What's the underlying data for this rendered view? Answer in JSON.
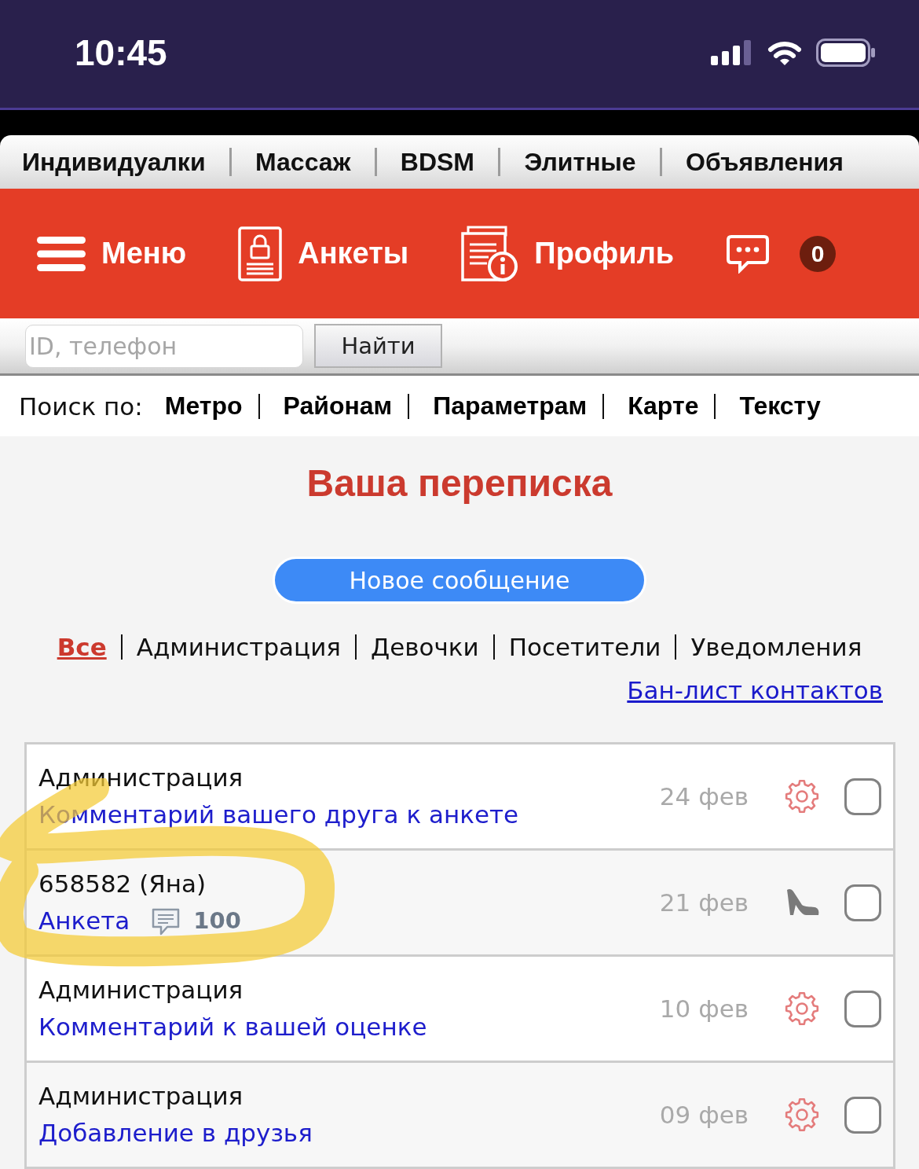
{
  "status_bar": {
    "time": "10:45"
  },
  "category_nav": {
    "items": [
      "Индивидуалки",
      "Массаж",
      "BDSM",
      "Элитные",
      "Объявления"
    ]
  },
  "main_nav": {
    "items": [
      {
        "kind": "menu",
        "label": "Меню"
      },
      {
        "kind": "profiles",
        "label": "Анкеты"
      },
      {
        "kind": "profile",
        "label": "Профиль"
      },
      {
        "kind": "messages",
        "badge": "0"
      }
    ]
  },
  "search": {
    "placeholder": "ID, телефон",
    "button": "Найти"
  },
  "search_by": {
    "label": "Поиск по:",
    "links": [
      "Метро",
      "Районам",
      "Параметрам",
      "Карте",
      "Тексту"
    ]
  },
  "title": "Ваша переписка",
  "new_message_button": "Новое сообщение",
  "filters": [
    {
      "label": "Все",
      "selected": true
    },
    {
      "label": "Администрация",
      "selected": false
    },
    {
      "label": "Девочки",
      "selected": false
    },
    {
      "label": "Посетители",
      "selected": false
    },
    {
      "label": "Уведомления",
      "selected": false
    }
  ],
  "ban_list_link": "Бан-лист контактов",
  "conversations": [
    {
      "kind": "admin",
      "sender": "Администрация",
      "subject": "Комментарий вашего друга к анкете",
      "date": "24 фев",
      "checked": false
    },
    {
      "kind": "girl",
      "sender": "658582 (Яна)",
      "subject": "Анкета",
      "comments": "100",
      "date": "21 фев",
      "checked": false
    },
    {
      "kind": "admin",
      "sender": "Администрация",
      "subject": "Комментарий к вашей оценке",
      "date": "10 фев",
      "checked": false
    },
    {
      "kind": "admin",
      "sender": "Администрация",
      "subject": "Добавление в друзья",
      "date": "09 фев",
      "checked": false
    }
  ]
}
